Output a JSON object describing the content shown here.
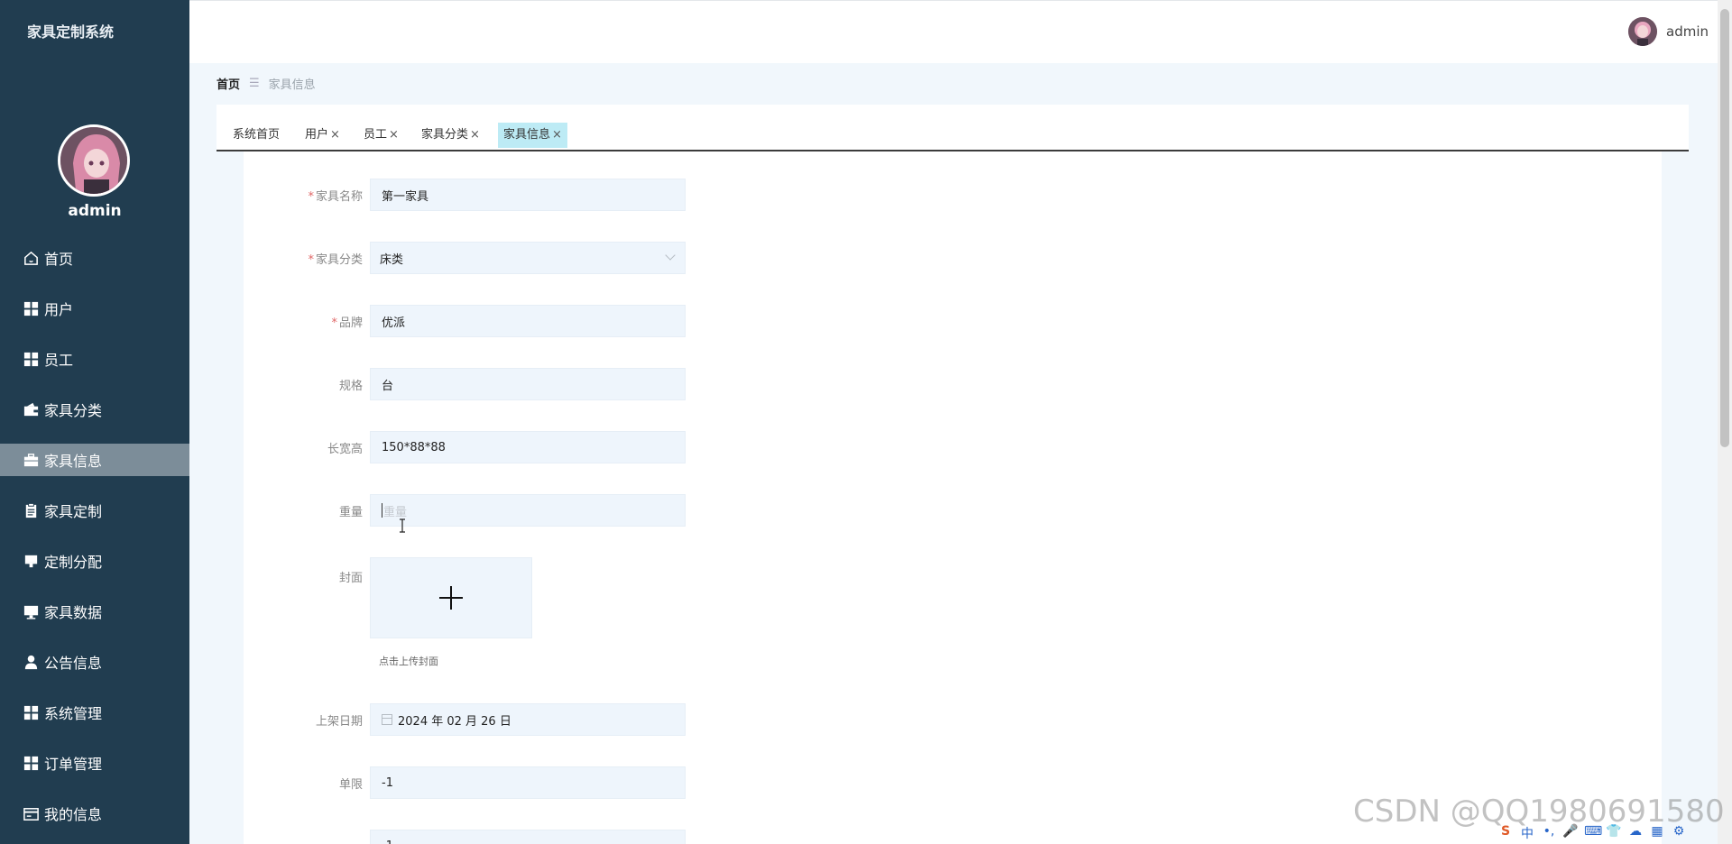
{
  "sidebar": {
    "app_title": "家具定制系统",
    "username": "admin",
    "items": [
      {
        "label": "首页",
        "icon": "home-icon",
        "active": false
      },
      {
        "label": "用户",
        "icon": "grid-icon",
        "active": false
      },
      {
        "label": "员工",
        "icon": "grid-icon",
        "active": false
      },
      {
        "label": "家具分类",
        "icon": "wallet-icon",
        "active": false
      },
      {
        "label": "家具信息",
        "icon": "briefcase-icon",
        "active": true
      },
      {
        "label": "家具定制",
        "icon": "clipboard-icon",
        "active": false
      },
      {
        "label": "定制分配",
        "icon": "stamp-icon",
        "active": false
      },
      {
        "label": "家具数据",
        "icon": "monitor-icon",
        "active": false
      },
      {
        "label": "公告信息",
        "icon": "user-icon",
        "active": false
      },
      {
        "label": "系统管理",
        "icon": "grid-icon",
        "active": false
      },
      {
        "label": "订单管理",
        "icon": "grid-icon",
        "active": false
      },
      {
        "label": "我的信息",
        "icon": "card-icon",
        "active": false
      }
    ]
  },
  "header": {
    "username": "admin"
  },
  "breadcrumb": {
    "home": "首页",
    "separator": "☰",
    "current": "家具信息"
  },
  "tabs": [
    {
      "label": "系统首页",
      "closable": false,
      "active": false
    },
    {
      "label": "用户",
      "closable": true,
      "active": false
    },
    {
      "label": "员工",
      "closable": true,
      "active": false
    },
    {
      "label": "家具分类",
      "closable": true,
      "active": false
    },
    {
      "label": "家具信息",
      "closable": true,
      "active": true
    }
  ],
  "tab_close": "×",
  "form": {
    "name": {
      "label": "家具名称",
      "value": "第一家具",
      "required": true
    },
    "category": {
      "label": "家具分类",
      "value": "床类",
      "required": true
    },
    "brand": {
      "label": "品牌",
      "value": "优派",
      "required": true
    },
    "spec": {
      "label": "规格",
      "value": "台",
      "required": false
    },
    "dimensions": {
      "label": "长宽高",
      "value": "150*88*88",
      "required": false
    },
    "weight": {
      "label": "重量",
      "placeholder": "重量",
      "required": false
    },
    "cover": {
      "label": "封面",
      "plus": "+",
      "hint": "点击上传封面"
    },
    "date": {
      "label": "上架日期",
      "value": "2024 年 02 月 26 日"
    },
    "limit": {
      "label": "单限",
      "value": "-1"
    },
    "next": {
      "value": "-1"
    }
  },
  "required_mark": "*",
  "watermark": "CSDN @QQ1980691580",
  "ime_bar": [
    "S",
    "中",
    "•,",
    "🎤",
    "⌨",
    "👕",
    "☁",
    "▦",
    "⚙"
  ],
  "colors": {
    "sidebar_bg": "#213d50",
    "active_menu_bg": "#7c8d99",
    "active_tab_bg": "#bdebf5",
    "input_bg": "#eef5fc",
    "required": "#e06767"
  }
}
